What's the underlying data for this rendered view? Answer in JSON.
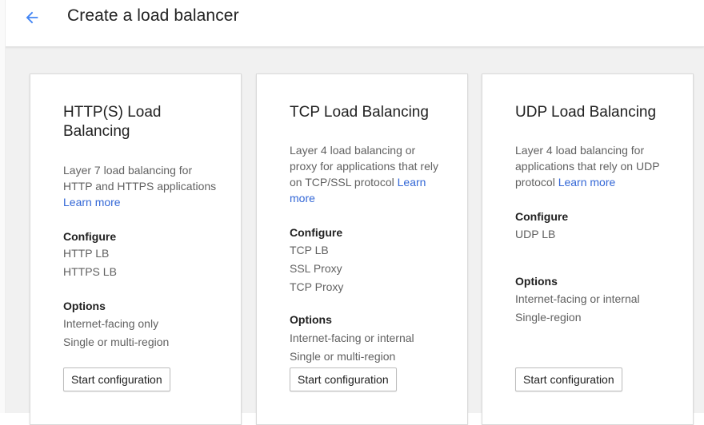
{
  "header": {
    "title": "Create a load balancer",
    "back_icon": "arrow-back-icon",
    "back_color": "#4285f4"
  },
  "colors": {
    "link": "#3367d6",
    "text": "#212121",
    "muted": "#616161",
    "background": "#f1f1f1"
  },
  "cards": [
    {
      "title": "HTTP(S) Load Balancing",
      "description": "Layer 7 load balancing for HTTP and HTTPS applications",
      "learn_more": "Learn more",
      "configure_heading": "Configure",
      "configure_items": [
        "HTTP LB",
        "HTTPS LB"
      ],
      "options_heading": "Options",
      "options_items": [
        "Internet-facing only",
        "Single or multi-region"
      ],
      "button_label": "Start configuration"
    },
    {
      "title": "TCP Load Balancing",
      "description": "Layer 4 load balancing or proxy for applications that rely on TCP/SSL protocol",
      "learn_more": "Learn more",
      "configure_heading": "Configure",
      "configure_items": [
        "TCP LB",
        "SSL Proxy",
        "TCP Proxy"
      ],
      "options_heading": "Options",
      "options_items": [
        "Internet-facing or internal",
        "Single or multi-region"
      ],
      "button_label": "Start configuration"
    },
    {
      "title": "UDP Load Balancing",
      "description": "Layer 4 load balancing for applications that rely on UDP protocol",
      "learn_more": "Learn more",
      "configure_heading": "Configure",
      "configure_items": [
        "UDP LB"
      ],
      "options_heading": "Options",
      "options_items": [
        "Internet-facing or internal",
        "Single-region"
      ],
      "button_label": "Start configuration"
    }
  ]
}
